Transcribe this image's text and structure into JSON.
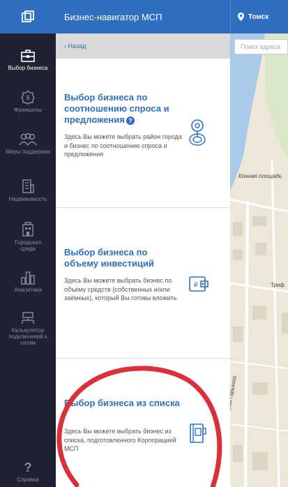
{
  "header": {
    "title": "Бизнес-навигатор МСП",
    "city": "Томск"
  },
  "back": {
    "label": "‹ Назад"
  },
  "search": {
    "placeholder": "Поиск адреса"
  },
  "sidebar": {
    "items": [
      {
        "label": "Выбор бизнеса",
        "icon": "briefcase-icon",
        "active": true
      },
      {
        "label": "Франшизы",
        "icon": "franchise-icon"
      },
      {
        "label": "Меры поддержки",
        "icon": "people-icon"
      },
      {
        "label": "Недвижимость",
        "icon": "building-icon"
      },
      {
        "label": "Городская среда",
        "icon": "city-icon"
      },
      {
        "label": "Аналитика",
        "icon": "chart-icon"
      },
      {
        "label": "Калькулятор подключений к сетям",
        "icon": "network-icon"
      },
      {
        "label": "Справка",
        "icon": "question-icon"
      }
    ]
  },
  "cards": [
    {
      "title": "Выбор бизнеса по соотношению спроса и предложения",
      "desc": "Здесь Вы можете выбрать район города и бизнес по соотношению спроса и предложения",
      "icon": "location-pin-icon"
    },
    {
      "title": "Выбор бизнеса по объему инвестиций",
      "desc": "Здесь Вы можете выбрать бизнес по объему средств (собственных и/или заёмных), который Вы готовы вложить",
      "icon": "wallet-icon"
    },
    {
      "title": "Выбор бизнеса из списка",
      "desc": "Здесь Вы можете выбрать бизнес из списка, подготовленного Корпорацией МСП",
      "icon": "list-book-icon"
    }
  ],
  "map": {
    "labels": [
      "Конная площадь",
      "Триф",
      "Максима Горького"
    ]
  },
  "colors": {
    "brand": "#2e6fc2",
    "sidebar": "#1f2230",
    "annotation": "#d9303a"
  }
}
